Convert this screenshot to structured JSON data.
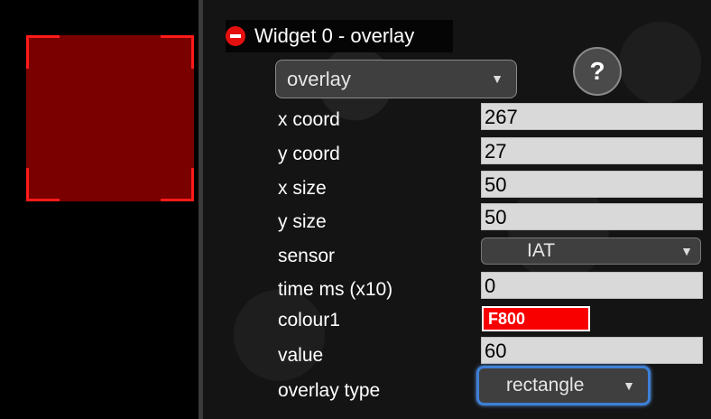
{
  "widget": {
    "header": "Widget 0 - overlay",
    "type_selected": "overlay",
    "help_label": "?"
  },
  "fields": {
    "x_coord": {
      "label": "x coord",
      "value": "267"
    },
    "y_coord": {
      "label": "y coord",
      "value": "27"
    },
    "x_size": {
      "label": "x size",
      "value": "50"
    },
    "y_size": {
      "label": "y size",
      "value": "50"
    },
    "sensor": {
      "label": "sensor",
      "value": "IAT"
    },
    "time_ms": {
      "label": "time ms (x10)",
      "value": "0"
    },
    "colour1": {
      "label": "colour1",
      "value": "F800"
    },
    "value": {
      "label": "value",
      "value": "60"
    },
    "overlay_type": {
      "label": "overlay type",
      "value": "rectangle"
    }
  },
  "colors": {
    "preview_fill": "#7a0000",
    "preview_corners": "#ff1a1a",
    "colour1_swatch": "#f80000",
    "focus_ring": "#3d7fd6"
  },
  "icons": {
    "remove": "minus-circle-icon",
    "dropdown": "triangle-down-icon"
  }
}
